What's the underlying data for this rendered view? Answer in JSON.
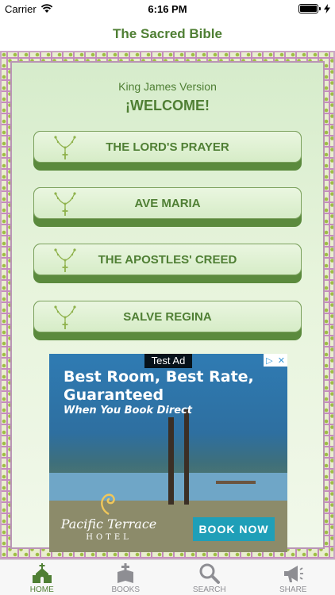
{
  "status_bar": {
    "carrier": "Carrier",
    "time": "6:16 PM"
  },
  "nav": {
    "title": "The Sacred Bible"
  },
  "main": {
    "subtitle": "King James Version",
    "welcome": "¡WELCOME!",
    "prayers": [
      {
        "label": "THE LORD'S PRAYER"
      },
      {
        "label": "AVE MARIA"
      },
      {
        "label": "THE APOSTLES' CREED"
      },
      {
        "label": "SALVE REGINA"
      }
    ]
  },
  "ad": {
    "label": "Test Ad",
    "headline": "Best Room, Best Rate, Guaranteed",
    "subline": "When You Book Direct",
    "brand": "Pacific Terrace",
    "brand_sub": "HOTEL",
    "cta": "BOOK NOW"
  },
  "tab_bar": {
    "tabs": [
      {
        "label": "HOME",
        "icon": "church-icon",
        "active": true
      },
      {
        "label": "BOOKS",
        "icon": "bible-icon",
        "active": false
      },
      {
        "label": "SEARCH",
        "icon": "search-icon",
        "active": false
      },
      {
        "label": "SHARE",
        "icon": "megaphone-icon",
        "active": false
      }
    ]
  },
  "colors": {
    "accent": "#4f7f34",
    "button_shadow": "#5b8a3d",
    "frame_dots": "#a6c24f",
    "frame_lines": "#c58fbe"
  }
}
